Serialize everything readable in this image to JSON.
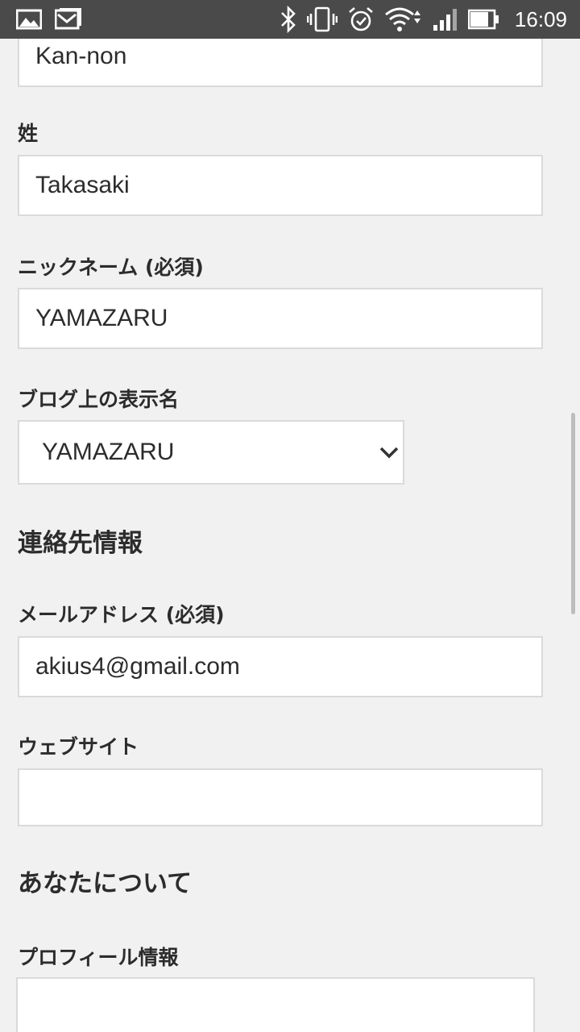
{
  "status_bar": {
    "time": "16:09",
    "icons": [
      "image-icon",
      "gmail-icon",
      "bluetooth-icon",
      "vibrate-icon",
      "alarm-icon",
      "wifi-icon",
      "signal-icon",
      "battery-icon"
    ]
  },
  "form": {
    "first_name": {
      "value": "Kan-non"
    },
    "last_name": {
      "label": "姓",
      "value": "Takasaki"
    },
    "nickname": {
      "label": "ニックネーム (必須)",
      "value": "YAMAZARU"
    },
    "display_name": {
      "label": "ブログ上の表示名",
      "selected": "YAMAZARU"
    },
    "contact_heading": "連絡先情報",
    "email": {
      "label": "メールアドレス (必須)",
      "value": "akius4@gmail.com"
    },
    "website": {
      "label": "ウェブサイト",
      "value": ""
    },
    "about_heading": "あなたについて",
    "profile": {
      "label": "プロフィール情報",
      "value": ""
    }
  }
}
